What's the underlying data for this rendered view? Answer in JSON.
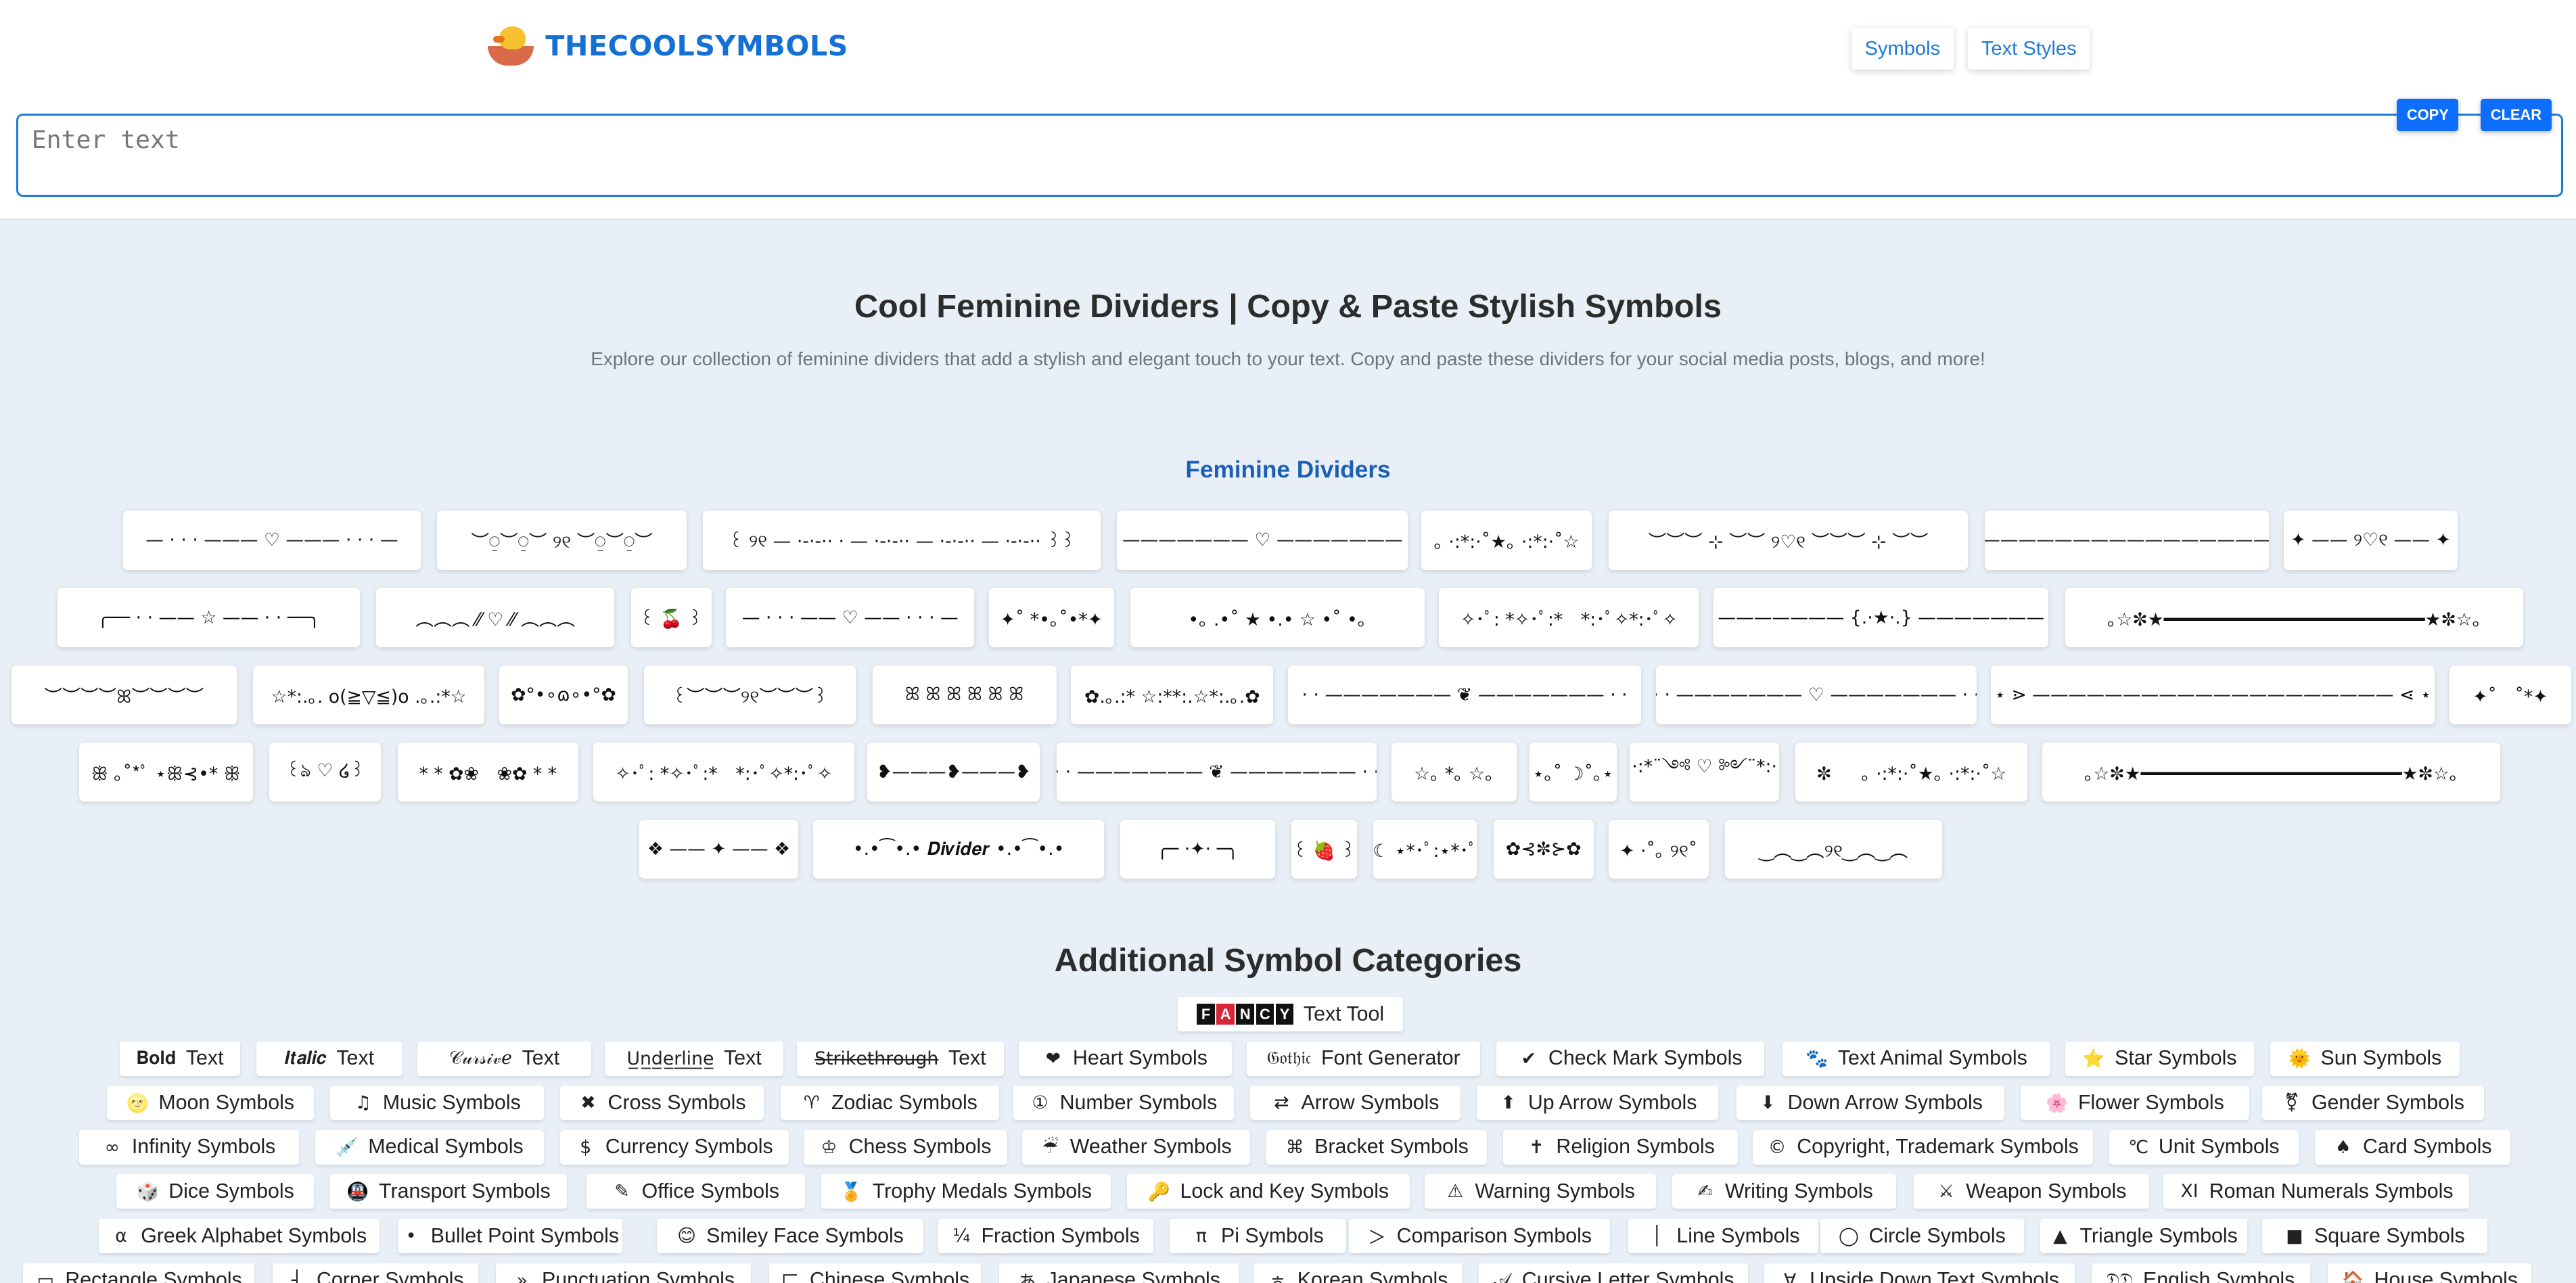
{
  "site": {
    "name": "THECOOLSYMBOLS"
  },
  "nav": [
    {
      "label": "Symbols"
    },
    {
      "label": "Text Styles"
    }
  ],
  "editor": {
    "placeholder": "Enter text",
    "value": "",
    "copy_label": "COPY",
    "clear_label": "CLEAR"
  },
  "page": {
    "title": "Cool Feminine Dividers | Copy & Paste Stylish Symbols",
    "subtitle": "Explore our collection of feminine dividers that add a stylish and elegant touch to your text. Copy and paste these dividers for your social media posts, blogs, and more!",
    "section_title": "Feminine Dividers",
    "additional_title": "Additional Symbol Categories"
  },
  "dividers": [
    "— · · · ——— ♡ ——— · · · —",
    "︶⍜︶⍜︶ ୨୧ ︶⍜︶⍜︶",
    "꒰ ୨୧ — ·-·-·· · — ·-·-·· — ·-·-·· — ·-·-·· ꒱꒱",
    "୨୧ ——————— ♡ ——————— ୨୧",
    "｡ ·:*:·˚★｡ ·:*:·˚☆",
    "︶︶︶ ⊹ ︶︶ ୨♡୧ ︶︶︶ ⊹ ︶︶",
    "➽————————————————➽",
    "✦ —— ୨♡୧ —— ✦",
    "╭── · · —— ☆ —— · · ──╮",
    "︵︵︵ ⁄⁄ ♡ ⁄⁄ ︵︵︵",
    "꒰ 🍒 ꒱",
    "— · · · —— ♡ —— · · · —",
    "✦˚ *•｡˚•*✦",
    "•｡ .•˚ ★ •.• ☆ •˚ •｡",
    "✧･ﾟ: *✧･ﾟ:*　*:･ﾟ✧*:･ﾟ✧",
    "⋗ ——————— {.·★·.} ——————— ⋖",
    "｡☆✼★━━━━━━━━━━━━━━━━━━━━━━━━★✼☆｡",
    "︶︶︶︶ꕤ︶︶︶︶",
    "☆*:.｡. o(≧▽≦)o .｡.:*☆",
    "✿°•∘ɷ∘•°✿",
    "꒰︶︶︶୨୧︶︶︶꒱",
    "ꕤ ꕤ ꕤ ꕤ ꕤ ꕤ",
    "✿.｡.:* ☆:**:.☆*:.｡.✿",
    "· · ——————— ❦ ——————— · ·",
    "· · ——————— ♡ ——————— · ·",
    "⋆ ⋗ ———————————————————— ⋖ ⋆",
    "✦˚　˚*✦",
    "ꕥ ｡˚*ﾟ ⋆ꕥ⊰•* ꕥ",
    "꒰ঌ ♡ ໒꒱",
    "* * ✿❀　❀✿ * *",
    "✧･ﾟ: *✧･ﾟ:*　*:･ﾟ✧*:･ﾟ✧",
    "❥———❥———❥",
    "· · ——————— ❦ ——————— · ·",
    "☆｡ *｡ ☆｡",
    "⋆｡˚ ☽˚｡⋆",
    "·:*¨༺ ♡ ༻¨*:·",
    "✼ 　 ｡ ·:*:·˚★｡ ·:*:·˚☆",
    "｡☆✼★━━━━━━━━━━━━━━━━━━━━━━━━★✼☆｡",
    "❖ —— ✦ —— ❖",
    "•.•⁀•.• 𝑫𝒊𝒗𝒊𝒅𝒆𝒓 •.•⁀•.•",
    "╭─ ·✦· ─╮",
    "꒰ 🍓 ꒱",
    "☾ ⋆*･ﾟ:⋆*･ﾟ",
    "✿⊰✼⊱✿",
    "✦ ·˚｡ ୨୧˚",
    "‿︵‿︵୨୧‿︵‿︵"
  ],
  "tool": {
    "badge": [
      "F",
      "A",
      "N",
      "C",
      "Y"
    ],
    "label": "Text Tool"
  },
  "categories": [
    {
      "icon": "𝐁𝐨𝐥𝐝",
      "label": "Text"
    },
    {
      "icon": "𝑰𝒕𝒂𝒍𝒊𝒄",
      "label": "Text"
    },
    {
      "icon": "𝒞𝓊𝓇𝓈𝒾𝓋ℯ",
      "label": "Text"
    },
    {
      "icon": "U̲n̲d̲e̲r̲l̲i̲n̲e̲",
      "label": "Text"
    },
    {
      "icon": "S̶t̶r̶i̶k̶e̶t̶h̶r̶o̶u̶g̶h̶",
      "label": "Text"
    },
    {
      "icon": "❤",
      "label": "Heart Symbols"
    },
    {
      "icon": "𝔊𝔬𝔱𝔥𝔦𝔠",
      "label": "Font Generator"
    },
    {
      "icon": "✔",
      "label": "Check Mark Symbols"
    },
    {
      "icon": "🐾",
      "label": "Text Animal Symbols"
    },
    {
      "icon": "⭐",
      "label": "Star Symbols"
    },
    {
      "icon": "🌞",
      "label": "Sun Symbols"
    },
    {
      "icon": "🌝",
      "label": "Moon Symbols"
    },
    {
      "icon": "♫",
      "label": "Music Symbols"
    },
    {
      "icon": "✖",
      "label": "Cross Symbols"
    },
    {
      "icon": "♈",
      "label": "Zodiac Symbols"
    },
    {
      "icon": "①",
      "label": "Number Symbols"
    },
    {
      "icon": "⇄",
      "label": "Arrow Symbols"
    },
    {
      "icon": "⬆",
      "label": "Up Arrow Symbols"
    },
    {
      "icon": "⬇",
      "label": "Down Arrow Symbols"
    },
    {
      "icon": "🌸",
      "label": "Flower Symbols"
    },
    {
      "icon": "⚧",
      "label": "Gender Symbols"
    },
    {
      "icon": "∞",
      "label": "Infinity Symbols"
    },
    {
      "icon": "💉",
      "label": "Medical Symbols"
    },
    {
      "icon": "$",
      "label": "Currency Symbols"
    },
    {
      "icon": "♔",
      "label": "Chess Symbols"
    },
    {
      "icon": "☔",
      "label": "Weather Symbols"
    },
    {
      "icon": "⌘",
      "label": "Bracket Symbols"
    },
    {
      "icon": "✝",
      "label": "Religion Symbols"
    },
    {
      "icon": "©",
      "label": "Copyright, Trademark Symbols"
    },
    {
      "icon": "℃",
      "label": "Unit Symbols"
    },
    {
      "icon": "♠",
      "label": "Card Symbols"
    },
    {
      "icon": "🎲",
      "label": "Dice Symbols"
    },
    {
      "icon": "🚇",
      "label": "Transport Symbols"
    },
    {
      "icon": "✎",
      "label": "Office Symbols"
    },
    {
      "icon": "🏅",
      "label": "Trophy Medals Symbols"
    },
    {
      "icon": "🔑",
      "label": "Lock and Key Symbols"
    },
    {
      "icon": "⚠",
      "label": "Warning Symbols"
    },
    {
      "icon": "✍",
      "label": "Writing Symbols"
    },
    {
      "icon": "⚔",
      "label": "Weapon Symbols"
    },
    {
      "icon": "XI",
      "label": "Roman Numerals Symbols"
    },
    {
      "icon": "α",
      "label": "Greek Alphabet Symbols"
    },
    {
      "icon": "•",
      "label": "Bullet Point Symbols"
    },
    {
      "icon": "😊",
      "label": "Smiley Face Symbols"
    },
    {
      "icon": "¼",
      "label": "Fraction Symbols"
    },
    {
      "icon": "π",
      "label": "Pi Symbols"
    },
    {
      "icon": "＞",
      "label": "Comparison Symbols"
    },
    {
      "icon": "│",
      "label": "Line Symbols"
    },
    {
      "icon": "◯",
      "label": "Circle Symbols"
    },
    {
      "icon": "▲",
      "label": "Triangle Symbols"
    },
    {
      "icon": "■",
      "label": "Square Symbols"
    },
    {
      "icon": "▭",
      "label": "Rectangle Symbols"
    },
    {
      "icon": "┤",
      "label": "Corner Symbols"
    },
    {
      "icon": "»",
      "label": "Punctuation Symbols"
    },
    {
      "icon": "⼕",
      "label": "Chinese Symbols"
    },
    {
      "icon": "あ",
      "label": "Japanese Symbols"
    },
    {
      "icon": "ㅎ",
      "label": "Korean Symbols"
    },
    {
      "icon": "𝒜",
      "label": "Cursive Letter Symbols"
    },
    {
      "icon": "∀",
      "label": "Upside Down Text Symbols"
    },
    {
      "icon": "𝔇𝔇",
      "label": "English  Symbols"
    },
    {
      "icon": "🏠",
      "label": "House Symbols"
    }
  ],
  "colors": {
    "accent": "#1e7ad8",
    "button": "#0d6efd",
    "background": "#e8eff7",
    "section_title": "#1d5fb3"
  }
}
